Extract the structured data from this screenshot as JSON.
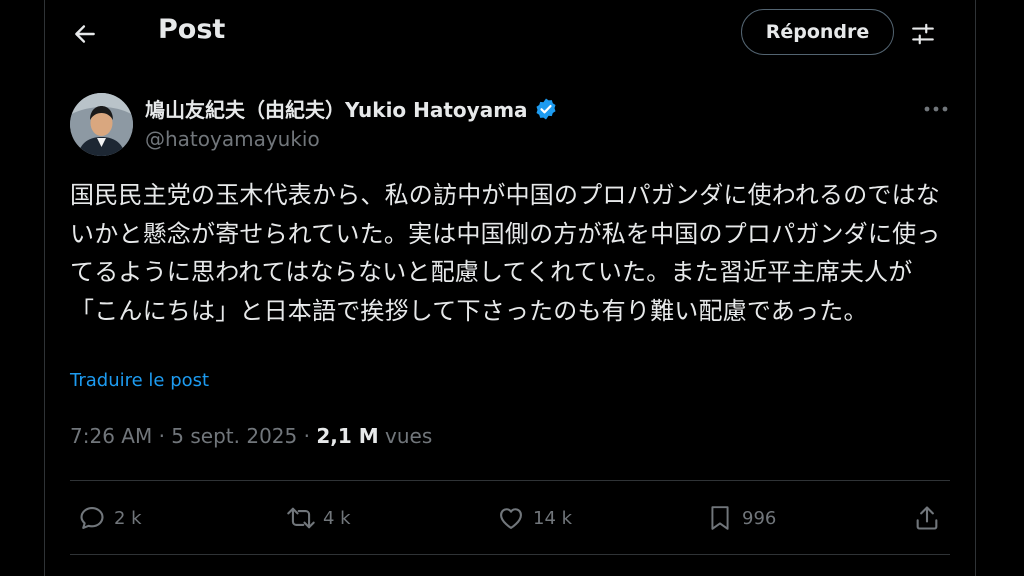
{
  "header": {
    "title": "Post",
    "reply_label": "Répondre"
  },
  "author": {
    "name": "鳩山友紀夫（由紀夫）Yukio Hatoyama",
    "handle": "@hatoyamayukio"
  },
  "tweet": {
    "text": "国民民主党の玉木代表から、私の訪中が中国のプロパガンダに使われるのではないかと懸念が寄せられていた。実は中国側の方が私を中国のプロパガンダに使ってるように思われてはならないと配慮してくれていた。また習近平主席夫人が「こんにちは」と日本語で挨拶して下さったのも有り難い配慮であった。",
    "translate_label": "Traduire le post",
    "time": "7:26 AM",
    "date": "5 sept. 2025",
    "views_count": "2,1 M",
    "views_label": "vues"
  },
  "actions": {
    "replies": "2 k",
    "reposts": "4 k",
    "likes": "14 k",
    "bookmarks": "996"
  },
  "icons": {
    "back": "arrow-left-icon",
    "filter": "sliders-icon",
    "verified": "verified-badge-icon",
    "more": "more-horizontal-icon",
    "reply": "comment-icon",
    "repost": "repost-icon",
    "like": "heart-icon",
    "bookmark": "bookmark-icon",
    "share": "share-icon"
  },
  "colors": {
    "background": "#000000",
    "text": "#e7e9ea",
    "secondary": "#71767b",
    "accent": "#1d9bf0"
  }
}
